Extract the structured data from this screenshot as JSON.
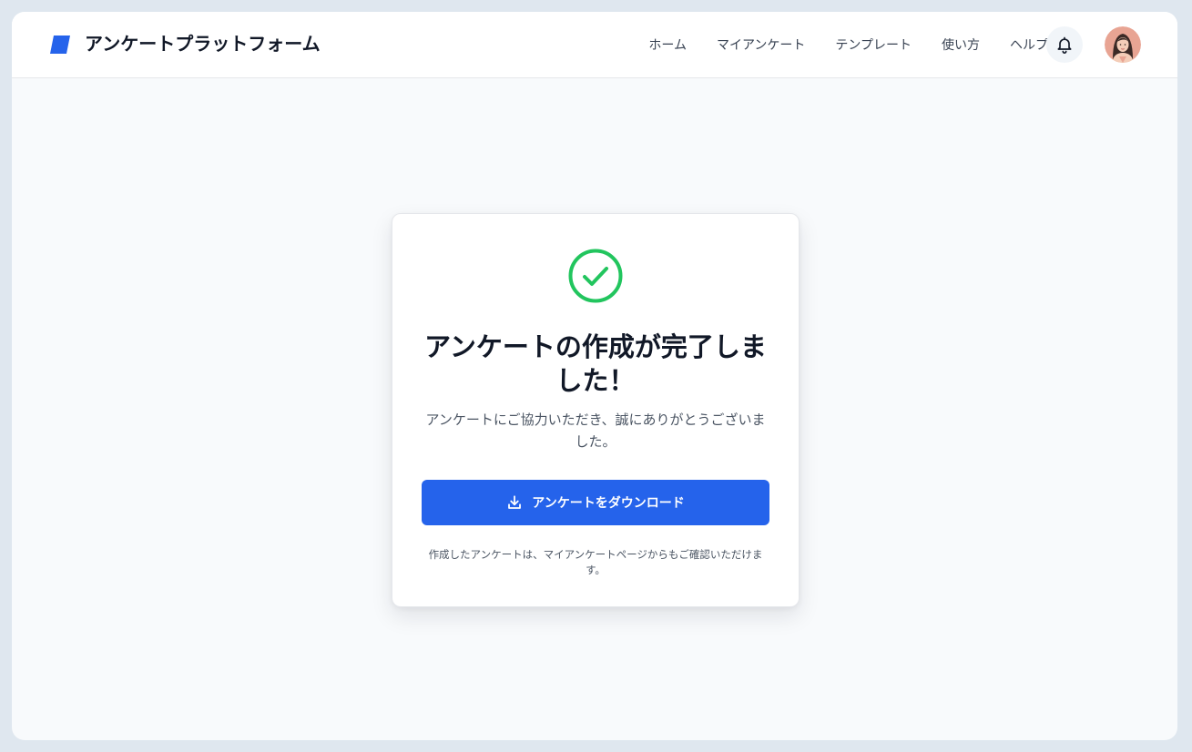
{
  "app": {
    "brand": "アンケートプラットフォーム"
  },
  "nav": {
    "items": [
      {
        "label": "ホーム"
      },
      {
        "label": "マイアンケート"
      },
      {
        "label": "テンプレート"
      },
      {
        "label": "使い方"
      },
      {
        "label": "ヘルプ"
      }
    ]
  },
  "header": {
    "notification_icon": "bell-icon",
    "avatar_icon": "user-avatar"
  },
  "success_card": {
    "icon": "check-circle-icon",
    "title": "アンケートの作成が完了しました！",
    "message": "アンケートにご協力いただき、誠にありがとうございました。",
    "download_label": "アンケートをダウンロード",
    "download_icon": "download-icon",
    "footnote": "作成したアンケートは、マイアンケートページからもご確認いただけます。"
  },
  "colors": {
    "accent": "#2563eb",
    "success": "#22c55e",
    "page_background": "#f8fafc"
  }
}
